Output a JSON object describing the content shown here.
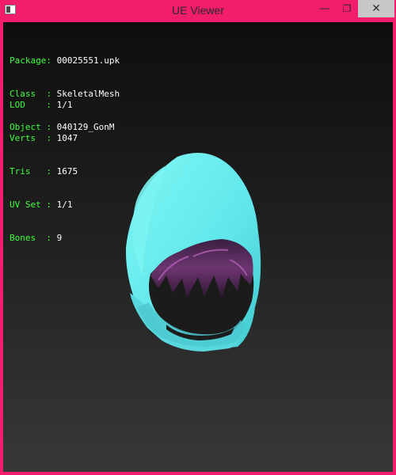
{
  "window": {
    "title": "UE Viewer",
    "controls": {
      "minimize": "—",
      "maximize": "❐",
      "close": "✕"
    }
  },
  "info_block_1": [
    {
      "label": "Package: ",
      "value": "00025551.upk"
    },
    {
      "label": "Class  : ",
      "value": "SkeletalMesh"
    },
    {
      "label": "Object : ",
      "value": "040129_GonM"
    }
  ],
  "info_block_2": [
    {
      "label": "LOD    : ",
      "value": "1/1"
    },
    {
      "label": "Verts  : ",
      "value": "1047"
    },
    {
      "label": "Tris   : ",
      "value": "1675"
    },
    {
      "label": "UV Set : ",
      "value": "1/1"
    },
    {
      "label": "Bones  : ",
      "value": "9"
    }
  ],
  "colors": {
    "frame": "#f21d6b",
    "label_green": "#3cff3c",
    "value_white": "#ffffff",
    "hood_cyan": "#6ff0f0",
    "hair_purple": "#5b2a5e"
  }
}
